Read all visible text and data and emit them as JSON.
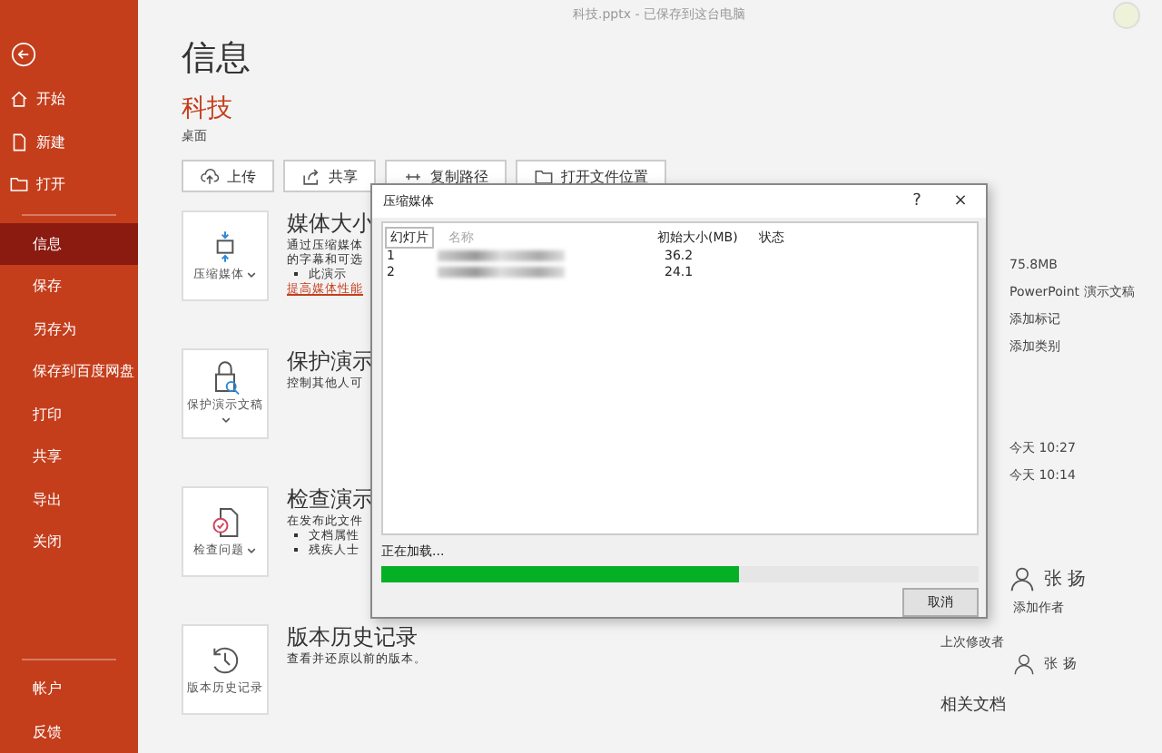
{
  "window": {
    "title": "科技.pptx - 已保存到这台电脑"
  },
  "sidebar": {
    "items": [
      {
        "label": "开始",
        "selected": false
      },
      {
        "label": "新建",
        "selected": false
      },
      {
        "label": "打开",
        "selected": false
      },
      {
        "label": "信息",
        "selected": true
      },
      {
        "label": "保存",
        "selected": false
      },
      {
        "label": "另存为",
        "selected": false
      },
      {
        "label": "保存到百度网盘",
        "selected": false
      },
      {
        "label": "打印",
        "selected": false
      },
      {
        "label": "共享",
        "selected": false
      },
      {
        "label": "导出",
        "selected": false
      },
      {
        "label": "关闭",
        "selected": false
      },
      {
        "label": "帐户",
        "selected": false
      },
      {
        "label": "反馈",
        "selected": false
      }
    ]
  },
  "page": {
    "heading": "信息",
    "file_name": "科技",
    "location": "桌面"
  },
  "actions": [
    {
      "label": "上传"
    },
    {
      "label": "共享"
    },
    {
      "label": "复制路径"
    },
    {
      "label": "打开文件位置"
    }
  ],
  "sections": [
    {
      "button": "压缩媒体",
      "dropdown": true,
      "title": "媒体大小",
      "description": [
        "通过压缩媒体",
        "的字幕和可选"
      ],
      "bullets": [
        "此演示"
      ],
      "link": "提高媒体性能"
    },
    {
      "button": "保护演示文稿",
      "dropdown": true,
      "title": "保护演示",
      "description": [
        "控制其他人可"
      ]
    },
    {
      "button": "检查问题",
      "dropdown": true,
      "title": "检查演示",
      "description": [
        "在发布此文件"
      ],
      "bullets": [
        "文档属性",
        "残疾人士"
      ]
    },
    {
      "button": "版本历史记录",
      "dropdown": false,
      "title": "版本历史记录",
      "description": [
        "查看并还原以前的版本。"
      ]
    }
  ],
  "properties": {
    "values": [
      "75.8MB",
      "PowerPoint 演示文稿",
      "添加标记",
      "添加类别"
    ],
    "dates": [
      "今天 10:27",
      "今天 10:14"
    ],
    "author": "张 扬",
    "add_author": "添加作者",
    "last_modified_label": "上次修改者",
    "last_modified_by": "张 扬",
    "related_label": "相关文档"
  },
  "dialog": {
    "title": "压缩媒体",
    "help": "?",
    "close": "×",
    "columns": [
      "幻灯片",
      "名称",
      "初始大小(MB)",
      "状态"
    ],
    "rows": [
      {
        "slide": "1",
        "size": "36.2"
      },
      {
        "slide": "2",
        "size": "24.1"
      }
    ],
    "status": "正在加载...",
    "progress": {
      "level": 0.6
    },
    "cancel": "取消"
  }
}
